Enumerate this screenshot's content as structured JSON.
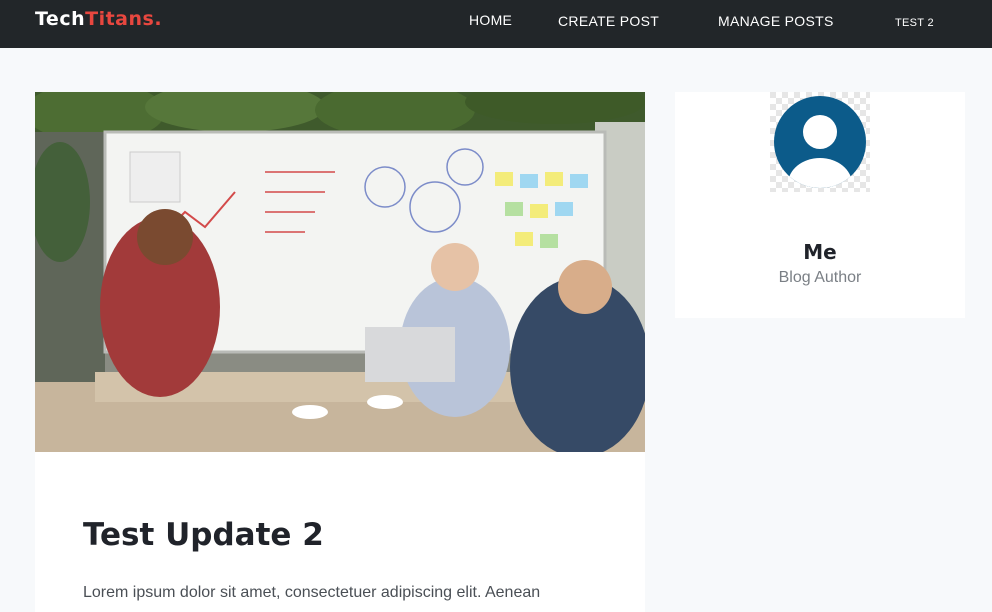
{
  "brand": {
    "name_part1": "Tech",
    "name_part2": "Titans.",
    "accent_color": "#e8473f"
  },
  "nav": {
    "items": [
      {
        "label": "HOME"
      },
      {
        "label": "CREATE POST"
      },
      {
        "label": "MANAGE POSTS"
      },
      {
        "label": "TEST 2"
      }
    ]
  },
  "post": {
    "image_description": "team-meeting-whiteboard-photo",
    "title": "Test Update 2",
    "excerpt": "Lorem ipsum dolor sit amet, consectetuer adipiscing elit. Aenean"
  },
  "author": {
    "avatar_icon": "user-avatar-icon",
    "name": "Me",
    "role": "Blog Author"
  }
}
